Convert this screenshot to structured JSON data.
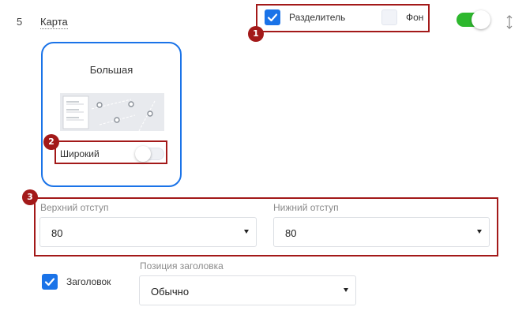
{
  "row": {
    "number": "5",
    "title": "Карта"
  },
  "options": {
    "divider_label": "Разделитель",
    "divider_checked": true,
    "background_label": "Фон",
    "background_checked": false,
    "enabled": true
  },
  "card": {
    "title": "Большая",
    "wide_label": "Широкий",
    "wide_enabled": false
  },
  "padding": {
    "top_label": "Верхний отступ",
    "top_value": "80",
    "bottom_label": "Нижний отступ",
    "bottom_value": "80"
  },
  "heading": {
    "checkbox_label": "Заголовок",
    "checked": true,
    "position_label": "Позиция заголовка",
    "position_value": "Обычно"
  },
  "annotations": [
    "1",
    "2",
    "3"
  ],
  "colors": {
    "accent": "#1a73e8",
    "highlight": "#a31919",
    "toggle_on": "#2eb82e"
  }
}
